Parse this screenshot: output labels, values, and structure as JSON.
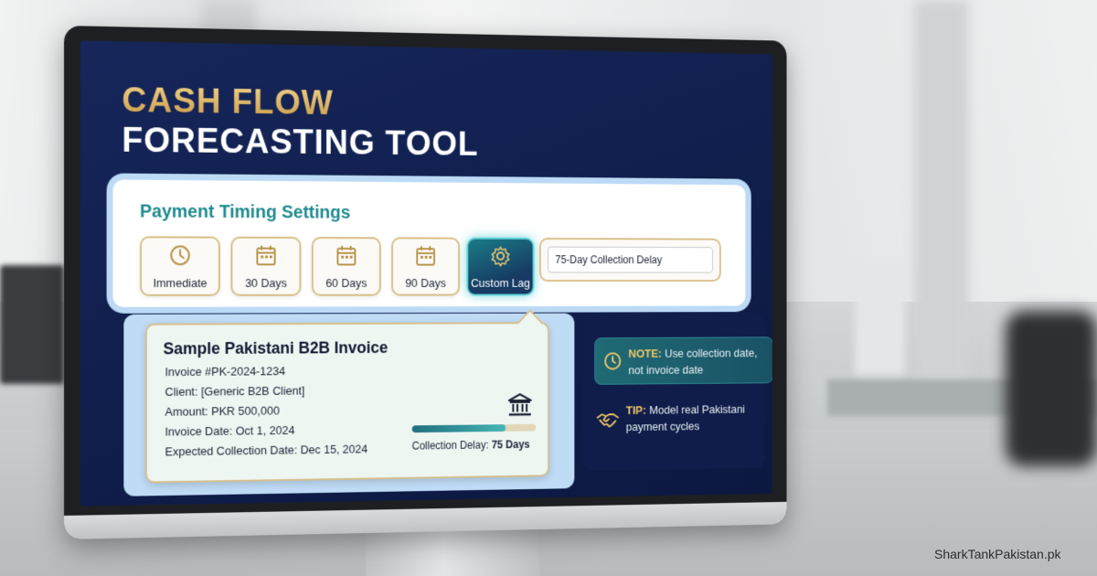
{
  "title": {
    "line1": "CASH FLOW",
    "line2": "FORECASTING TOOL"
  },
  "settings": {
    "heading": "Payment Timing Settings",
    "options": [
      {
        "label": "Immediate",
        "icon": "clock-icon"
      },
      {
        "label": "30 Days",
        "icon": "calendar-icon"
      },
      {
        "label": "60 Days",
        "icon": "calendar-icon"
      },
      {
        "label": "90 Days",
        "icon": "calendar-icon"
      },
      {
        "label": "Custom Lag",
        "icon": "gear-icon",
        "selected": true
      }
    ],
    "custom_value": "75-Day Collection Delay"
  },
  "invoice": {
    "title": "Sample Pakistani B2B Invoice",
    "number": "Invoice #PK-2024-1234",
    "client": "Client: [Generic B2B Client]",
    "amount": "Amount: PKR 500,000",
    "invoice_date": "Invoice Date: Oct 1, 2024",
    "expected_date": "Expected Collection Date: Dec 15, 2024",
    "delay_label": "Collection Delay:",
    "delay_value": "75 Days",
    "delay_progress": 0.75
  },
  "note": {
    "label": "NOTE:",
    "text_1": "Use collection date,",
    "text_2": "not invoice date"
  },
  "tip": {
    "label": "TIP:",
    "text_1": "Model real Pakistani",
    "text_2": "payment cycles"
  },
  "watermark": "SharkTankPakistan.pk",
  "colors": {
    "navy": "#0f1d4a",
    "gold": "#d8be86",
    "teal": "#1f8b8e"
  }
}
